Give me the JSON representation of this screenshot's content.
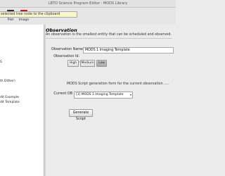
{
  "window": {
    "title": "LBTO Science Program Editor - MODS Library"
  },
  "toolbar": {
    "buttons": [
      {
        "label": "Plot",
        "icon": "plot-icon",
        "color": "#2a2a2a"
      },
      {
        "label": "Image",
        "icon": "image-icon",
        "color": "#c21a1a"
      }
    ],
    "tooltip": "selected tree node to the clipboard"
  },
  "tree": {
    "items": [
      {
        "label": "S"
      },
      {
        "label": "th Dither)"
      },
      {
        "label": "dit Example"
      },
      {
        "label": "dit Template"
      }
    ]
  },
  "observation": {
    "section_title": "Observation",
    "description": "An observation is the smallest entity that can be scheduled and observed.",
    "name_label": "Observation Name",
    "name_value": "MODS 1 Imaging Template",
    "id_label": "Observation Id:",
    "id_value": "",
    "priority_label": "Priority",
    "priority_options": [
      "High",
      "Medium",
      "Low"
    ],
    "priority_selected": "Low",
    "script_desc": "MODS Script generation form for the current observation .....",
    "current_ob_label": "Current OB",
    "current_ob_value": "[1] MODS 1 Imaging Template",
    "generate_label": "Generate Script"
  }
}
